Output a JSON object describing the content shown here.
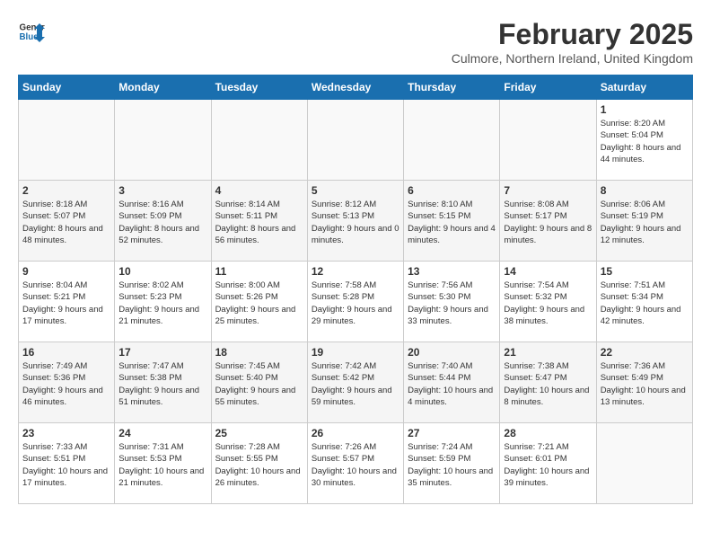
{
  "header": {
    "logo_line1": "General",
    "logo_line2": "Blue",
    "month_year": "February 2025",
    "location": "Culmore, Northern Ireland, United Kingdom"
  },
  "weekdays": [
    "Sunday",
    "Monday",
    "Tuesday",
    "Wednesday",
    "Thursday",
    "Friday",
    "Saturday"
  ],
  "weeks": [
    [
      {
        "day": "",
        "info": ""
      },
      {
        "day": "",
        "info": ""
      },
      {
        "day": "",
        "info": ""
      },
      {
        "day": "",
        "info": ""
      },
      {
        "day": "",
        "info": ""
      },
      {
        "day": "",
        "info": ""
      },
      {
        "day": "1",
        "info": "Sunrise: 8:20 AM\nSunset: 5:04 PM\nDaylight: 8 hours and 44 minutes."
      }
    ],
    [
      {
        "day": "2",
        "info": "Sunrise: 8:18 AM\nSunset: 5:07 PM\nDaylight: 8 hours and 48 minutes."
      },
      {
        "day": "3",
        "info": "Sunrise: 8:16 AM\nSunset: 5:09 PM\nDaylight: 8 hours and 52 minutes."
      },
      {
        "day": "4",
        "info": "Sunrise: 8:14 AM\nSunset: 5:11 PM\nDaylight: 8 hours and 56 minutes."
      },
      {
        "day": "5",
        "info": "Sunrise: 8:12 AM\nSunset: 5:13 PM\nDaylight: 9 hours and 0 minutes."
      },
      {
        "day": "6",
        "info": "Sunrise: 8:10 AM\nSunset: 5:15 PM\nDaylight: 9 hours and 4 minutes."
      },
      {
        "day": "7",
        "info": "Sunrise: 8:08 AM\nSunset: 5:17 PM\nDaylight: 9 hours and 8 minutes."
      },
      {
        "day": "8",
        "info": "Sunrise: 8:06 AM\nSunset: 5:19 PM\nDaylight: 9 hours and 12 minutes."
      }
    ],
    [
      {
        "day": "9",
        "info": "Sunrise: 8:04 AM\nSunset: 5:21 PM\nDaylight: 9 hours and 17 minutes."
      },
      {
        "day": "10",
        "info": "Sunrise: 8:02 AM\nSunset: 5:23 PM\nDaylight: 9 hours and 21 minutes."
      },
      {
        "day": "11",
        "info": "Sunrise: 8:00 AM\nSunset: 5:26 PM\nDaylight: 9 hours and 25 minutes."
      },
      {
        "day": "12",
        "info": "Sunrise: 7:58 AM\nSunset: 5:28 PM\nDaylight: 9 hours and 29 minutes."
      },
      {
        "day": "13",
        "info": "Sunrise: 7:56 AM\nSunset: 5:30 PM\nDaylight: 9 hours and 33 minutes."
      },
      {
        "day": "14",
        "info": "Sunrise: 7:54 AM\nSunset: 5:32 PM\nDaylight: 9 hours and 38 minutes."
      },
      {
        "day": "15",
        "info": "Sunrise: 7:51 AM\nSunset: 5:34 PM\nDaylight: 9 hours and 42 minutes."
      }
    ],
    [
      {
        "day": "16",
        "info": "Sunrise: 7:49 AM\nSunset: 5:36 PM\nDaylight: 9 hours and 46 minutes."
      },
      {
        "day": "17",
        "info": "Sunrise: 7:47 AM\nSunset: 5:38 PM\nDaylight: 9 hours and 51 minutes."
      },
      {
        "day": "18",
        "info": "Sunrise: 7:45 AM\nSunset: 5:40 PM\nDaylight: 9 hours and 55 minutes."
      },
      {
        "day": "19",
        "info": "Sunrise: 7:42 AM\nSunset: 5:42 PM\nDaylight: 9 hours and 59 minutes."
      },
      {
        "day": "20",
        "info": "Sunrise: 7:40 AM\nSunset: 5:44 PM\nDaylight: 10 hours and 4 minutes."
      },
      {
        "day": "21",
        "info": "Sunrise: 7:38 AM\nSunset: 5:47 PM\nDaylight: 10 hours and 8 minutes."
      },
      {
        "day": "22",
        "info": "Sunrise: 7:36 AM\nSunset: 5:49 PM\nDaylight: 10 hours and 13 minutes."
      }
    ],
    [
      {
        "day": "23",
        "info": "Sunrise: 7:33 AM\nSunset: 5:51 PM\nDaylight: 10 hours and 17 minutes."
      },
      {
        "day": "24",
        "info": "Sunrise: 7:31 AM\nSunset: 5:53 PM\nDaylight: 10 hours and 21 minutes."
      },
      {
        "day": "25",
        "info": "Sunrise: 7:28 AM\nSunset: 5:55 PM\nDaylight: 10 hours and 26 minutes."
      },
      {
        "day": "26",
        "info": "Sunrise: 7:26 AM\nSunset: 5:57 PM\nDaylight: 10 hours and 30 minutes."
      },
      {
        "day": "27",
        "info": "Sunrise: 7:24 AM\nSunset: 5:59 PM\nDaylight: 10 hours and 35 minutes."
      },
      {
        "day": "28",
        "info": "Sunrise: 7:21 AM\nSunset: 6:01 PM\nDaylight: 10 hours and 39 minutes."
      },
      {
        "day": "",
        "info": ""
      }
    ]
  ]
}
